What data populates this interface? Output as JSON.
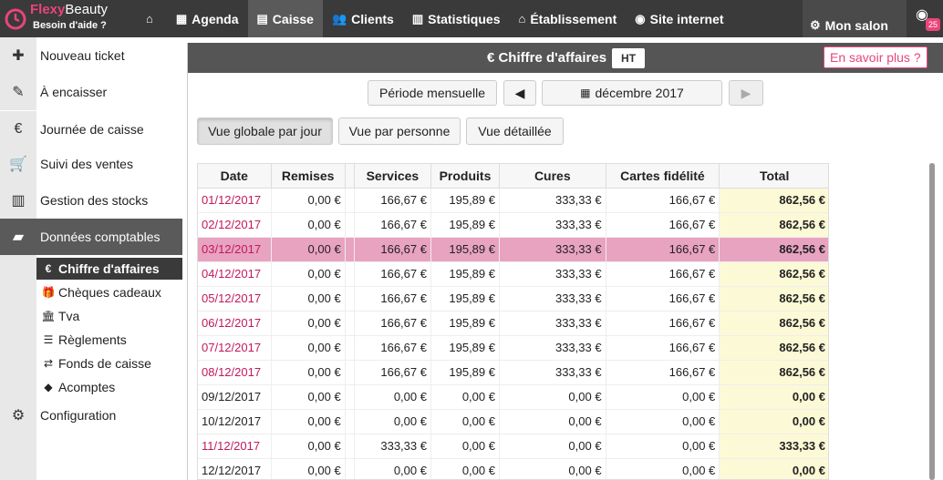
{
  "brand": {
    "name_part1": "Flexy",
    "name_part2": "Beauty",
    "help": "Besoin d'aide ?"
  },
  "nav": [
    {
      "label": "",
      "icon": "home-icon"
    },
    {
      "label": "Agenda",
      "icon": "calendar-icon"
    },
    {
      "label": "Caisse",
      "icon": "register-icon",
      "active": true
    },
    {
      "label": "Clients",
      "icon": "users-icon"
    },
    {
      "label": "Statistiques",
      "icon": "chart-icon"
    },
    {
      "label": "Établissement",
      "icon": "home-icon"
    },
    {
      "label": "Site internet",
      "icon": "globe-icon"
    }
  ],
  "salon": "Mon salon",
  "notifications": "25",
  "sidebar": {
    "items": [
      {
        "label": "Nouveau ticket",
        "icon": "ticket-plus-icon"
      },
      {
        "label": "À encaisser",
        "icon": "ticket-pay-icon"
      },
      {
        "label": "Journée de caisse",
        "icon": "euro-book-icon"
      },
      {
        "label": "Suivi des ventes",
        "icon": "cart-icon"
      },
      {
        "label": "Gestion des stocks",
        "icon": "barcode-icon"
      },
      {
        "label": "Données comptables",
        "icon": "book-icon",
        "active": true
      },
      {
        "label": "Configuration",
        "icon": "gears-icon"
      }
    ],
    "sub": [
      {
        "label": "Chiffre d'affaires",
        "icon": "euro-icon",
        "active": true
      },
      {
        "label": "Chèques cadeaux",
        "icon": "gift-icon"
      },
      {
        "label": "Tva",
        "icon": "bank-icon"
      },
      {
        "label": "Règlements",
        "icon": "list-icon"
      },
      {
        "label": "Fonds de caisse",
        "icon": "exchange-icon"
      },
      {
        "label": "Acomptes",
        "icon": "tag-icon"
      }
    ]
  },
  "panel": {
    "title": "€ Chiffre d'affaires",
    "ht": "HT",
    "learn": "En savoir plus ?"
  },
  "period": {
    "mode": "Période mensuelle",
    "month": "décembre 2017"
  },
  "views": {
    "global": "Vue globale par jour",
    "person": "Vue par personne",
    "detail": "Vue détaillée"
  },
  "table": {
    "headers": [
      "Date",
      "Remises",
      "",
      "Services",
      "Produits",
      "Cures",
      "Cartes fidélité",
      "Total"
    ],
    "rows": [
      [
        "01/12/2017",
        "0,00 €",
        "",
        "166,67 €",
        "195,89 €",
        "333,33 €",
        "166,67 €",
        "862,56 €"
      ],
      [
        "02/12/2017",
        "0,00 €",
        "",
        "166,67 €",
        "195,89 €",
        "333,33 €",
        "166,67 €",
        "862,56 €"
      ],
      [
        "03/12/2017",
        "0,00 €",
        "",
        "166,67 €",
        "195,89 €",
        "333,33 €",
        "166,67 €",
        "862,56 €"
      ],
      [
        "04/12/2017",
        "0,00 €",
        "",
        "166,67 €",
        "195,89 €",
        "333,33 €",
        "166,67 €",
        "862,56 €"
      ],
      [
        "05/12/2017",
        "0,00 €",
        "",
        "166,67 €",
        "195,89 €",
        "333,33 €",
        "166,67 €",
        "862,56 €"
      ],
      [
        "06/12/2017",
        "0,00 €",
        "",
        "166,67 €",
        "195,89 €",
        "333,33 €",
        "166,67 €",
        "862,56 €"
      ],
      [
        "07/12/2017",
        "0,00 €",
        "",
        "166,67 €",
        "195,89 €",
        "333,33 €",
        "166,67 €",
        "862,56 €"
      ],
      [
        "08/12/2017",
        "0,00 €",
        "",
        "166,67 €",
        "195,89 €",
        "333,33 €",
        "166,67 €",
        "862,56 €"
      ],
      [
        "09/12/2017",
        "0,00 €",
        "",
        "0,00 €",
        "0,00 €",
        "0,00 €",
        "0,00 €",
        "0,00 €"
      ],
      [
        "10/12/2017",
        "0,00 €",
        "",
        "0,00 €",
        "0,00 €",
        "0,00 €",
        "0,00 €",
        "0,00 €"
      ],
      [
        "11/12/2017",
        "0,00 €",
        "",
        "333,33 €",
        "0,00 €",
        "0,00 €",
        "0,00 €",
        "333,33 €"
      ],
      [
        "12/12/2017",
        "0,00 €",
        "",
        "0,00 €",
        "0,00 €",
        "0,00 €",
        "0,00 €",
        "0,00 €"
      ]
    ],
    "highlight_row": 2,
    "plain_date_rows": [
      8,
      9,
      11
    ]
  },
  "colors": {
    "accent": "#e8457a",
    "highlight": "#e8a3c0",
    "total_bg": "#fcf9d6",
    "header": "#3a3a3a"
  }
}
